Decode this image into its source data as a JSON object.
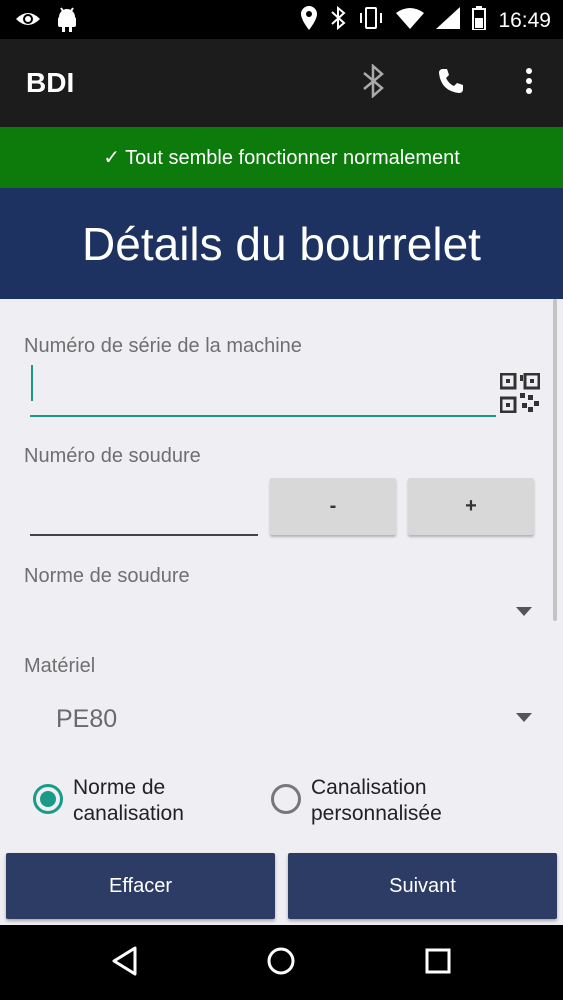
{
  "status_bar": {
    "time": "16:49",
    "left_icons": [
      "eye-icon",
      "android-icon"
    ],
    "right_icons": [
      "location-icon",
      "bluetooth-icon",
      "vibrate-icon",
      "wifi-icon",
      "signal-icon",
      "battery-icon"
    ]
  },
  "app_bar": {
    "title": "BDI",
    "actions": [
      "bluetooth-icon",
      "phone-icon",
      "more-vert-icon"
    ]
  },
  "banner": {
    "text": "✓ Tout semble fonctionner normalement",
    "color": "#0d7a0c"
  },
  "header": {
    "title": "Détails du bourrelet",
    "color": "#1d3260"
  },
  "form": {
    "serial_label": "Numéro de série de la machine",
    "serial_value": "",
    "weld_number_label": "Numéro de soudure",
    "weld_number_value": "",
    "minus_label": "-",
    "plus_label": "+",
    "weld_norm_label": "Norme de soudure",
    "weld_norm_value": "",
    "material_label": "Matériel",
    "material_value": "PE80",
    "radio_norm_label": "Norme de canalisation",
    "radio_norm_checked": true,
    "radio_custom_label": "Canalisation personnalisée",
    "radio_custom_checked": false,
    "accent_color": "#1a9b89"
  },
  "buttons": {
    "clear": "Effacer",
    "next": "Suivant",
    "color": "#2c3c64"
  },
  "nav_bar": {
    "buttons": [
      "back-icon",
      "home-icon",
      "recents-icon"
    ]
  }
}
